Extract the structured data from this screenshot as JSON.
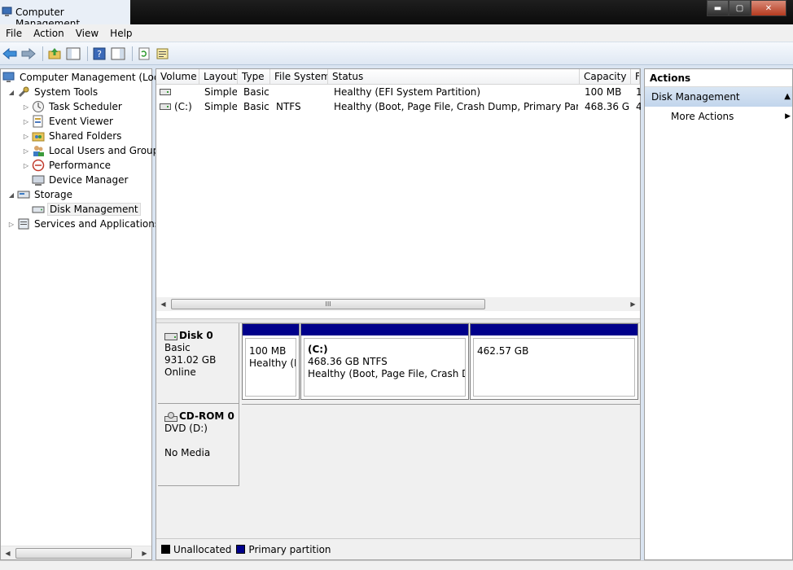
{
  "window": {
    "title": "Computer Management",
    "buttons": {
      "minimize": "▬",
      "maximize": "▢",
      "close": "✕"
    }
  },
  "menu": {
    "items": [
      "File",
      "Action",
      "View",
      "Help"
    ]
  },
  "toolbar": {
    "icons": [
      "back-arrow-icon",
      "forward-arrow-icon",
      "up-folder-icon",
      "show-hide-console-tree-icon",
      "help-icon",
      "show-hide-action-pane-icon",
      "refresh-icon",
      "properties-icon"
    ]
  },
  "tree": {
    "items": [
      {
        "label": "Computer Management (Local",
        "icon": "computer-icon",
        "level": 0,
        "arrow": ""
      },
      {
        "label": "System Tools",
        "icon": "tools-icon",
        "level": 1,
        "arrow": "◢"
      },
      {
        "label": "Task Scheduler",
        "icon": "clock-icon",
        "level": 2,
        "arrow": "▷"
      },
      {
        "label": "Event Viewer",
        "icon": "event-viewer-icon",
        "level": 2,
        "arrow": "▷"
      },
      {
        "label": "Shared Folders",
        "icon": "shared-folder-icon",
        "level": 2,
        "arrow": "▷"
      },
      {
        "label": "Local Users and Groups",
        "icon": "users-icon",
        "level": 2,
        "arrow": "▷"
      },
      {
        "label": "Performance",
        "icon": "performance-icon",
        "level": 2,
        "arrow": "▷"
      },
      {
        "label": "Device Manager",
        "icon": "device-manager-icon",
        "level": 2,
        "arrow": ""
      },
      {
        "label": "Storage",
        "icon": "storage-icon",
        "level": 1,
        "arrow": "◢"
      },
      {
        "label": "Disk Management",
        "icon": "disk-management-icon",
        "level": 2,
        "arrow": "",
        "selected": true
      },
      {
        "label": "Services and Applications",
        "icon": "services-icon",
        "level": 1,
        "arrow": "▷"
      }
    ]
  },
  "volume_list": {
    "columns": [
      "Volume",
      "Layout",
      "Type",
      "File System",
      "Status",
      "Capacity",
      "F"
    ],
    "rows": [
      {
        "volume": "",
        "layout": "Simple",
        "type": "Basic",
        "file_system": "",
        "status": "Healthy (EFI System Partition)",
        "capacity": "100 MB",
        "free": "1"
      },
      {
        "volume": "(C:)",
        "layout": "Simple",
        "type": "Basic",
        "file_system": "NTFS",
        "status": "Healthy (Boot, Page File, Crash Dump, Primary Partition)",
        "capacity": "468.36 GB",
        "free": "4"
      }
    ],
    "scroll_grip": "III"
  },
  "disks": [
    {
      "name": "Disk 0",
      "type": "Basic",
      "size": "931.02 GB",
      "state": "Online",
      "partitions": [
        {
          "title": "",
          "line1": "100 MB",
          "line2": "Healthy (EFI"
        },
        {
          "title": "(C:)",
          "line1": "468.36 GB NTFS",
          "line2": "Healthy (Boot, Page File, Crash Dum"
        },
        {
          "title": "",
          "line1": "462.57 GB",
          "line2": ""
        }
      ]
    },
    {
      "name": "CD-ROM 0",
      "type": "DVD (D:)",
      "size": "",
      "state": "No Media"
    }
  ],
  "legend": {
    "items": [
      {
        "label": "Unallocated",
        "color": "#000000"
      },
      {
        "label": "Primary partition",
        "color": "#00008b"
      }
    ]
  },
  "actions": {
    "title": "Actions",
    "section": "Disk Management",
    "items": [
      "More Actions"
    ]
  }
}
